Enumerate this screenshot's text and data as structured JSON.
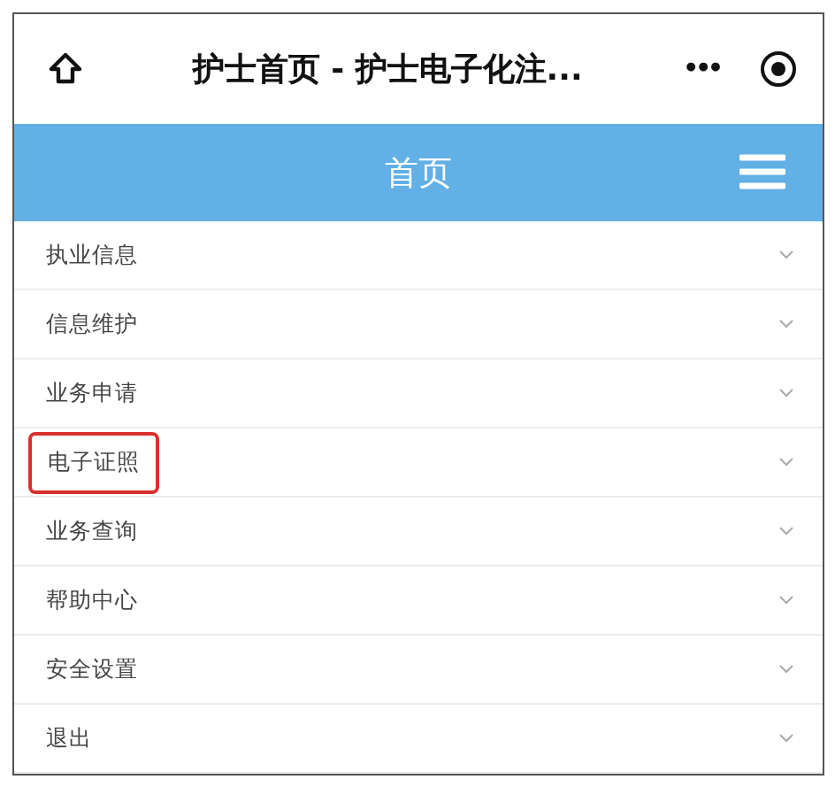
{
  "title_bar": {
    "title": "护士首页 - 护士电子化注...",
    "more": "•••"
  },
  "header": {
    "title": "首页"
  },
  "menu": [
    {
      "label": "执业信息",
      "highlighted": false
    },
    {
      "label": "信息维护",
      "highlighted": false
    },
    {
      "label": "业务申请",
      "highlighted": false
    },
    {
      "label": "电子证照",
      "highlighted": true
    },
    {
      "label": "业务查询",
      "highlighted": false
    },
    {
      "label": "帮助中心",
      "highlighted": false
    },
    {
      "label": "安全设置",
      "highlighted": false
    },
    {
      "label": "退出",
      "highlighted": false
    }
  ]
}
